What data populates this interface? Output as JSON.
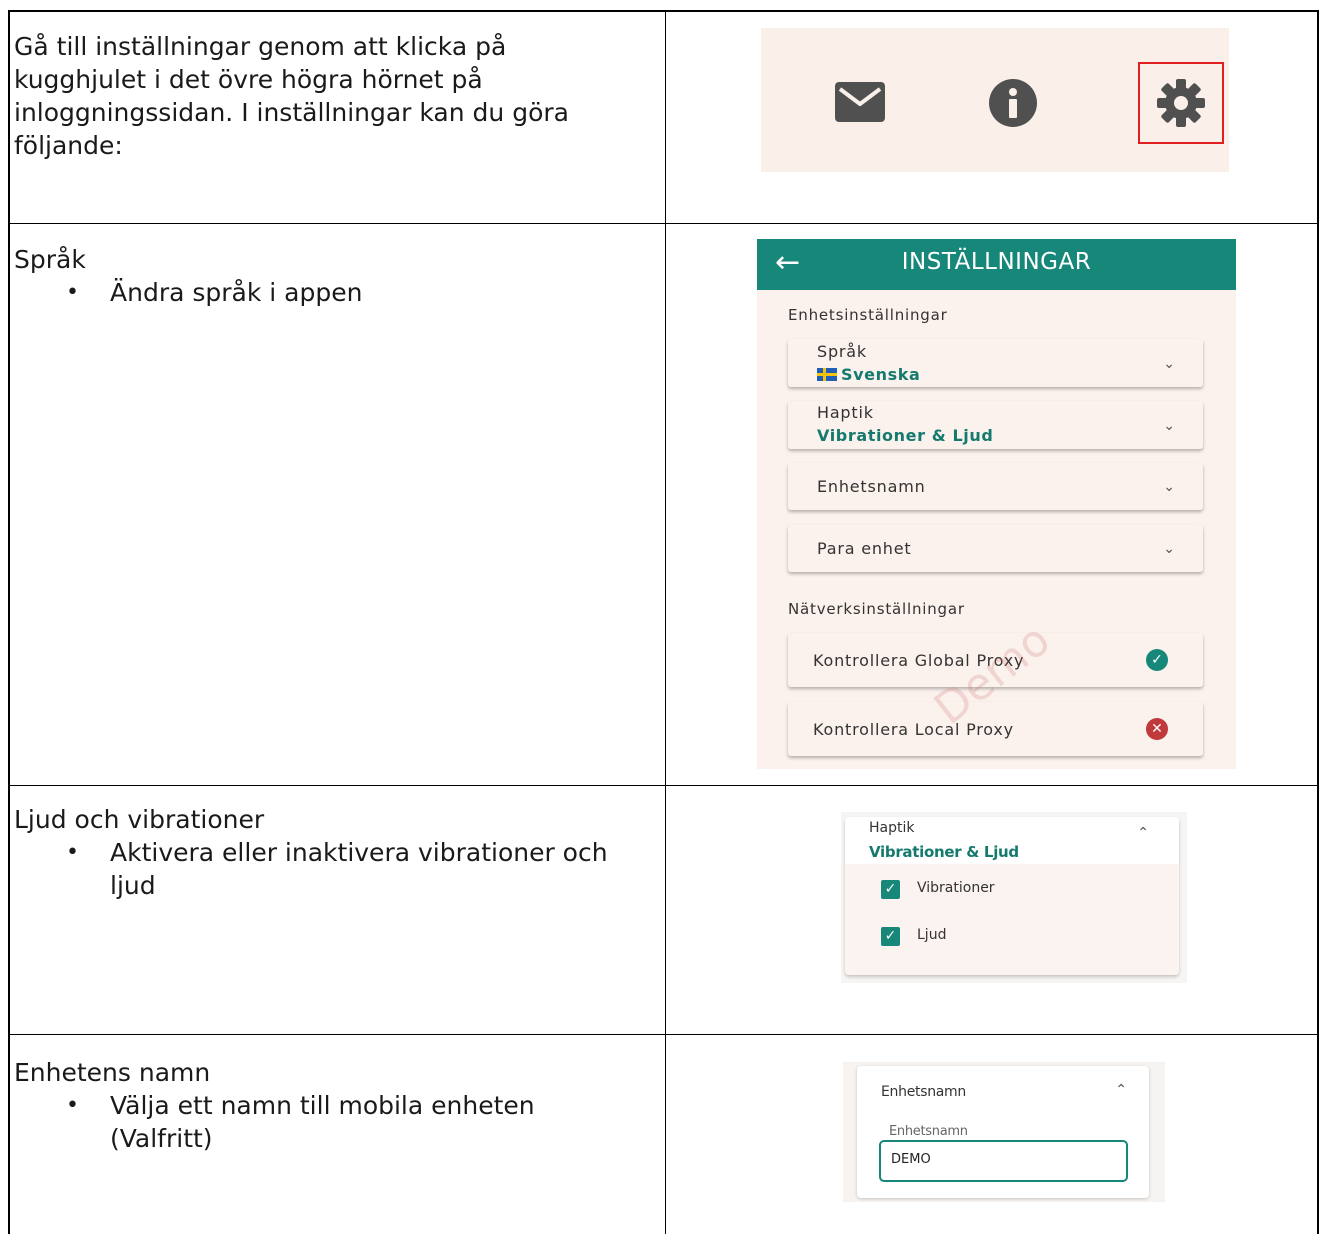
{
  "rows": [
    {
      "text": "Gå till inställningar genom att klicka på kugghjulet i det övre högra hörnet på inloggningssidan. I inställningar kan du göra följande:"
    },
    {
      "heading": "Språk",
      "bullets": [
        "Ändra språk i appen"
      ]
    },
    {
      "heading": "Ljud och vibrationer",
      "bullets": [
        "Aktivera eller inaktivera vibrationer och ljud"
      ]
    },
    {
      "heading": "Enhetens namn",
      "bullets": [
        "Välja ett namn till mobila enheten (Valfritt)"
      ]
    }
  ],
  "toolbar_icons": [
    "mail-icon",
    "info-icon",
    "gear-icon"
  ],
  "settings_screen": {
    "title": "INSTÄLLNINGAR",
    "device_section": "Enhetsinställningar",
    "items": [
      {
        "label": "Språk",
        "value": "Svenska"
      },
      {
        "label": "Haptik",
        "value": "Vibrationer & Ljud"
      },
      {
        "label": "Enhetsnamn"
      },
      {
        "label": "Para enhet"
      }
    ],
    "network_section": "Nätverksinställningar",
    "network_items": [
      {
        "label": "Kontrollera Global Proxy",
        "status": "ok"
      },
      {
        "label": "Kontrollera Local Proxy",
        "status": "error"
      }
    ],
    "watermark": "Demo"
  },
  "haptik_expanded": {
    "label": "Haptik",
    "value": "Vibrationer & Ljud",
    "options": [
      {
        "label": "Vibrationer",
        "checked": true
      },
      {
        "label": "Ljud",
        "checked": true
      }
    ]
  },
  "name_expanded": {
    "label": "Enhetsnamn",
    "field_label": "Enhetsnamn",
    "field_value": "DEMO"
  },
  "colors": {
    "accent": "#17877a",
    "highlight": "#e02020",
    "ok": "#17877a",
    "error": "#c0393b"
  }
}
